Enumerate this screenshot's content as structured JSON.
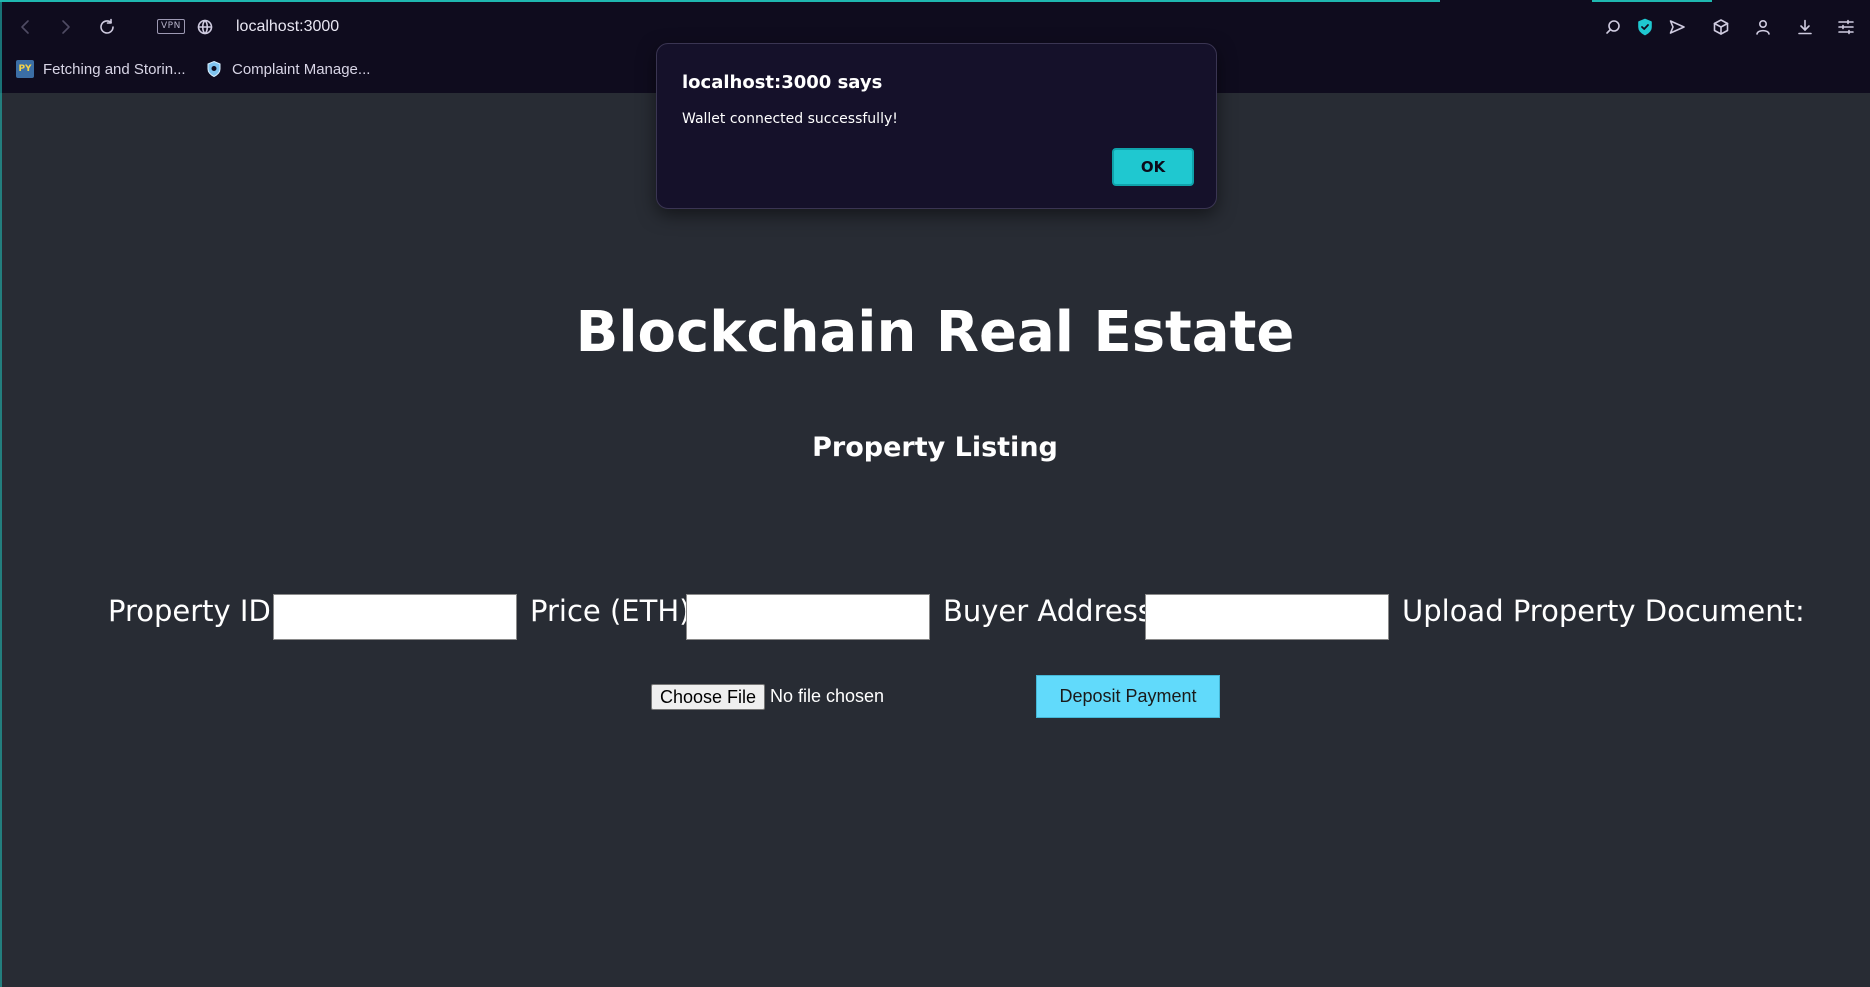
{
  "browser": {
    "url": "localhost:3000",
    "vpn_label": "VPN",
    "bookmarks": [
      {
        "label": "Fetching and Storin...",
        "icon": "python-icon"
      },
      {
        "label": "Complaint Manage...",
        "icon": "shield-icon"
      }
    ],
    "accent_color": "#1fb8b0"
  },
  "dialog": {
    "title": "localhost:3000 says",
    "message": "Wallet connected successfully!",
    "ok_label": "OK"
  },
  "page": {
    "title": "Blockchain Real Estate",
    "subtitle": "Property Listing",
    "fields": {
      "property_id_label": "Property ID:",
      "property_id_value": "",
      "price_label": "Price (ETH):",
      "price_value": "",
      "buyer_label": "Buyer Address:",
      "buyer_value": "",
      "upload_label": "Upload Property Document:"
    },
    "file_button_label": "Choose File",
    "file_status": "No file chosen",
    "deposit_button_label": "Deposit Payment",
    "deposit_button_color": "#61dafb",
    "background_color": "#282c34"
  }
}
